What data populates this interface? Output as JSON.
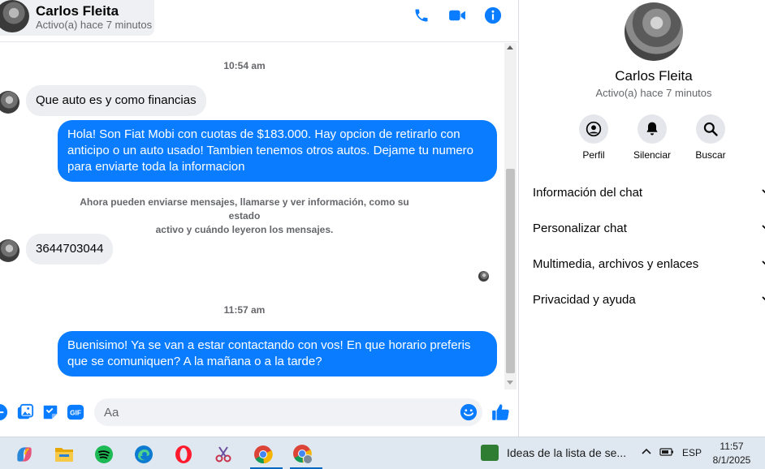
{
  "chat": {
    "contact_name": "Carlos Fleita",
    "contact_status": "Activo(a) hace 7 minutos",
    "messages": [
      {
        "type": "timestamp",
        "text": "10:54 am"
      },
      {
        "type": "incoming",
        "text": "Que auto es y como financias"
      },
      {
        "type": "outgoing",
        "text": "Hola! Son Fiat Mobi con cuotas de $183.000. Hay opcion de retirarlo con anticipo o un auto usado! Tambien tenemos otros autos. Dejame tu numero para enviarte toda la informacion"
      },
      {
        "type": "system",
        "line1": "Ahora pueden enviarse mensajes, llamarse y ver información, como su estado",
        "line2": "activo y cuándo leyeron los mensajes."
      },
      {
        "type": "incoming",
        "text": "3644703044"
      },
      {
        "type": "timestamp",
        "text": "11:57 am"
      },
      {
        "type": "outgoing",
        "text": "Buenisimo! Ya se van a estar contactando con vos! En que horario preferis que se comuniquen? A la mañana o a la tarde?"
      }
    ],
    "composer": {
      "placeholder": "Aa",
      "value": ""
    },
    "colors": {
      "outgoing_bubble": "#0a7cff",
      "incoming_bubble": "#eceef1",
      "accent": "#0a7cff"
    }
  },
  "info_panel": {
    "name": "Carlos Fleita",
    "status": "Activo(a) hace 7 minutos",
    "actions": [
      {
        "label": "Perfil",
        "icon": "profile-icon"
      },
      {
        "label": "Silenciar",
        "icon": "bell-icon"
      },
      {
        "label": "Buscar",
        "icon": "search-icon"
      }
    ],
    "sections": [
      {
        "label": "Información del chat"
      },
      {
        "label": "Personalizar chat"
      },
      {
        "label": "Multimedia, archivos y enlaces"
      },
      {
        "label": "Privacidad y ayuda"
      }
    ]
  },
  "taskbar": {
    "apps": [
      "copilot-icon",
      "file-explorer-icon",
      "spotify-icon",
      "edge-icon",
      "opera-icon",
      "snipping-tool-icon",
      "chrome-icon",
      "chrome-profile-icon"
    ],
    "widget_text": "Ideas de la lista de se...",
    "language": "ESP",
    "time": "11:57",
    "date": "8/1/2025"
  }
}
